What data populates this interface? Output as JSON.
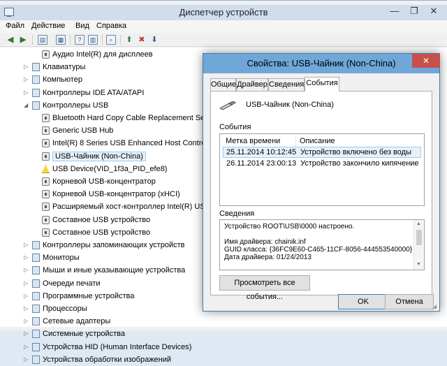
{
  "window": {
    "title": "Диспетчер устройств",
    "min": "—",
    "max": "❐",
    "close": "✕"
  },
  "menu": [
    "Файл",
    "Действие",
    "Вид",
    "Справка"
  ],
  "tree": [
    {
      "label": "Аудио Intel(R) для дисплеев",
      "icon": "speaker-icon",
      "indent": 2
    },
    {
      "label": "Клавиатуры",
      "icon": "keyboard-icon",
      "indent": 1
    },
    {
      "label": "Компьютер",
      "icon": "computer-icon",
      "indent": 1
    },
    {
      "label": "Контроллеры IDE ATA/ATAPI",
      "icon": "ide-controller-icon",
      "indent": 1
    },
    {
      "label": "Контроллеры USB",
      "icon": "usb-controller-icon",
      "indent": 1,
      "expanded": true
    },
    {
      "label": "Bluetooth Hard Copy Cable Replacement Server",
      "icon": "usb-device-icon",
      "indent": 2
    },
    {
      "label": "Generic USB Hub",
      "icon": "usb-device-icon",
      "indent": 2
    },
    {
      "label": "Intel(R) 8 Series USB Enhanced Host Controller #1 - 9C26",
      "icon": "usb-device-icon",
      "indent": 2
    },
    {
      "label": "USB-Чайник (Non-China)",
      "icon": "usb-device-icon",
      "indent": 2,
      "selected": true
    },
    {
      "label": "USB Device(VID_1f3a_PID_efe8)",
      "icon": "warning-icon",
      "indent": 2
    },
    {
      "label": "Корневой USB-концентратор",
      "icon": "usb-device-icon",
      "indent": 2
    },
    {
      "label": "Корневой USB-концентратор (xHCI)",
      "icon": "usb-device-icon",
      "indent": 2
    },
    {
      "label": "Расширяемый хост-контроллер Intel(R) USB 3.0 - 9C31",
      "icon": "usb-device-icon",
      "indent": 2
    },
    {
      "label": "Составное USB устройство",
      "icon": "usb-device-icon",
      "indent": 2
    },
    {
      "label": "Составное USB устройство",
      "icon": "usb-device-icon",
      "indent": 2
    },
    {
      "label": "Контроллеры запоминающих устройств",
      "icon": "storage-controller-icon",
      "indent": 1
    },
    {
      "label": "Мониторы",
      "icon": "monitor-icon",
      "indent": 1
    },
    {
      "label": "Мыши и иные указывающие устройства",
      "icon": "mouse-icon",
      "indent": 1
    },
    {
      "label": "Очереди печати",
      "icon": "printer-icon",
      "indent": 1
    },
    {
      "label": "Программные устройства",
      "icon": "software-device-icon",
      "indent": 1
    },
    {
      "label": "Процессоры",
      "icon": "processor-icon",
      "indent": 1
    },
    {
      "label": "Сетевые адаптеры",
      "icon": "network-adapter-icon",
      "indent": 1
    },
    {
      "label": "Системные устройства",
      "icon": "system-device-icon",
      "indent": 1
    },
    {
      "label": "Устройства HID (Human Interface Devices)",
      "icon": "hid-icon",
      "indent": 1
    },
    {
      "label": "Устройства обработки изображений",
      "icon": "imaging-device-icon",
      "indent": 1
    }
  ],
  "dialog": {
    "title": "Свойства: USB-Чайник (Non-China)",
    "close": "✕",
    "tabs": [
      "Общие",
      "Драйвер",
      "Сведения",
      "События"
    ],
    "device_name": "USB-Чайник (Non-China)",
    "events_label": "События",
    "columns": [
      "Метка времени",
      "Описание"
    ],
    "events": [
      {
        "time": "25.11.2014 10:12:45",
        "desc": "Устройство включено без воды"
      },
      {
        "time": "26.11.2014 23:00:13",
        "desc": "Устройство закончило кипячение"
      }
    ],
    "details_label": "Сведения",
    "details": [
      "Устройство ROOT\\USB\\0000 настроено.",
      "",
      "Имя драйвера: chainik.inf",
      "GUID класса: {36FC9E60-C465-11CF-8056-444553540000}",
      "Дата драйвера: 01/24/2013"
    ],
    "view_all": "Просмотреть все события...",
    "ok": "OK",
    "cancel": "Отмена"
  }
}
